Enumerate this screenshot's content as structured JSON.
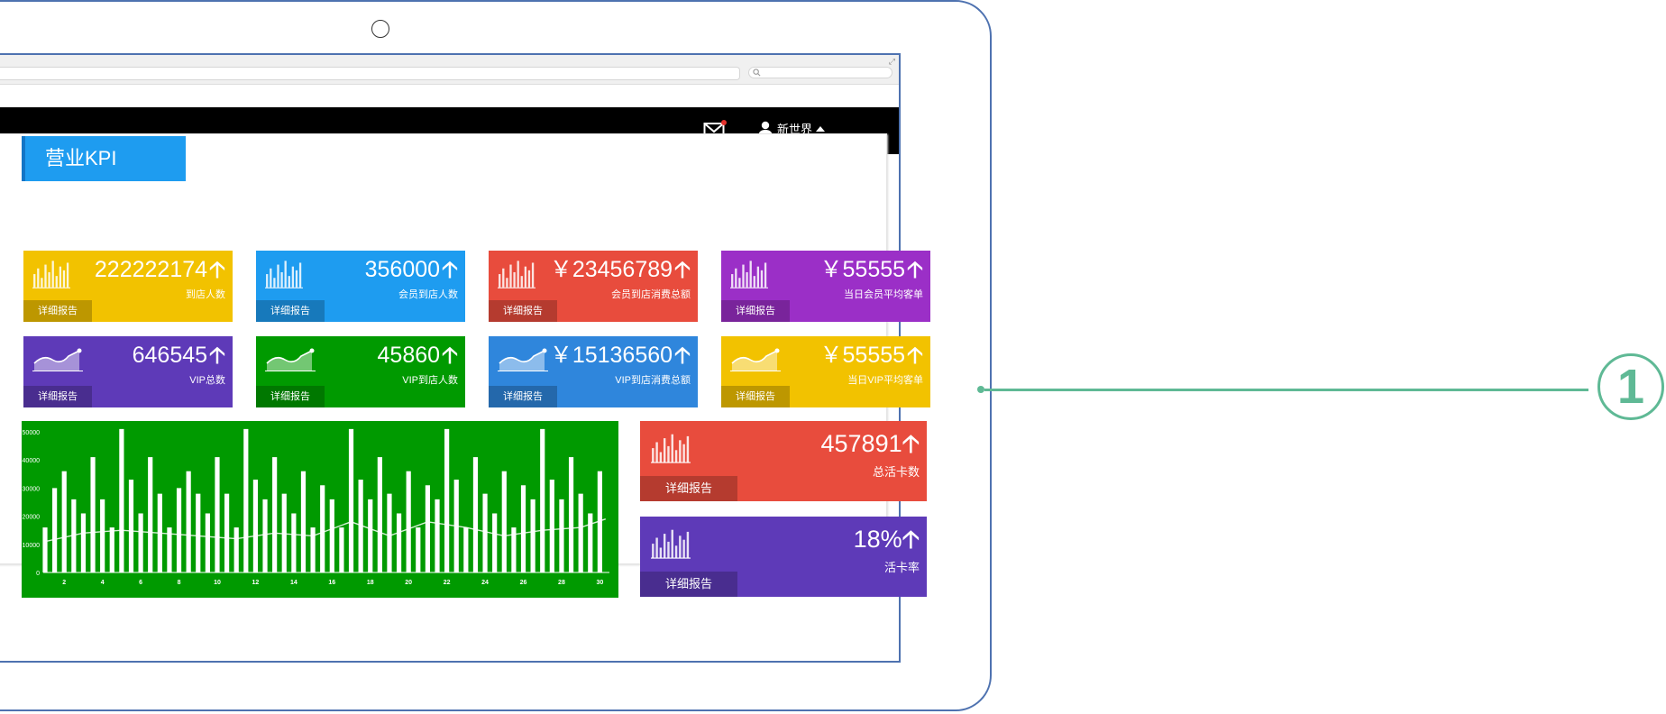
{
  "header": {
    "user_name": "新世界"
  },
  "section": {
    "title": "营业KPI"
  },
  "kpi_cards": [
    {
      "value": "222222174",
      "label": "到店人数",
      "button": "详细报告",
      "color": "#f2c200",
      "icon": "bar-chart-icon"
    },
    {
      "value": "356000",
      "label": "会员到店人数",
      "button": "详细报告",
      "color": "#1e9cf0",
      "icon": "bar-chart-icon"
    },
    {
      "value": "￥23456789",
      "label": "会员到店消费总额",
      "button": "详细报告",
      "color": "#e84c3d",
      "icon": "bar-chart-icon"
    },
    {
      "value": "￥55555",
      "label": "当日会员平均客单",
      "button": "详细报告",
      "color": "#9b2fc7",
      "icon": "bar-chart-icon"
    },
    {
      "value": "646545",
      "label": "VIP总数",
      "button": "详细报告",
      "color": "#5e3ab8",
      "icon": "area-chart-icon"
    },
    {
      "value": "45860",
      "label": "VIP到店人数",
      "button": "详细报告",
      "color": "#009a00",
      "icon": "area-chart-icon"
    },
    {
      "value": "￥15136560",
      "label": "VIP到店消费总额",
      "button": "详细报告",
      "color": "#2f86dc",
      "icon": "area-chart-icon"
    },
    {
      "value": "￥55555",
      "label": "当日VIP平均客单",
      "button": "详细报告",
      "color": "#f2c200",
      "icon": "area-chart-icon"
    }
  ],
  "big_cards": [
    {
      "value": "457891",
      "label": "总活卡数",
      "button": "详细报告",
      "color": "#e84c3d",
      "icon": "bar-chart-icon"
    },
    {
      "value": "18%",
      "label": "活卡率",
      "button": "详细报告",
      "color": "#5e3ab8",
      "icon": "bar-chart-icon"
    }
  ],
  "chart_data": {
    "type": "bar",
    "title": "",
    "xlabel": "",
    "ylabel": "",
    "ylim": [
      0,
      50000
    ],
    "y_ticks": [
      0,
      10000,
      20000,
      30000,
      40000,
      50000
    ],
    "x_ticks": [
      2,
      4,
      6,
      8,
      10,
      12,
      14,
      16,
      18,
      20,
      22,
      24,
      26,
      28,
      30
    ],
    "x_range": [
      1,
      30.5
    ],
    "background": "#009a00",
    "bar_color": "#ffffff",
    "series": [
      {
        "x": [
          1,
          1.5,
          2,
          2.5,
          3,
          3.5,
          4,
          4.5,
          5,
          5.5,
          6,
          6.5,
          7,
          7.5,
          8,
          8.5,
          9,
          9.5,
          10,
          10.5,
          11,
          11.5,
          12,
          12.5,
          13,
          13.5,
          14,
          14.5,
          15,
          15.5,
          16,
          16.5,
          17,
          17.5,
          18,
          18.5,
          19,
          19.5,
          20,
          20.5,
          21,
          21.5,
          22,
          22.5,
          23,
          23.5,
          24,
          24.5,
          25,
          25.5,
          26,
          26.5,
          27,
          27.5,
          28,
          28.5,
          29,
          29.5,
          30
        ],
        "values": [
          16000,
          30000,
          36000,
          26000,
          21000,
          41000,
          26000,
          16000,
          51000,
          33000,
          21000,
          41000,
          28000,
          16000,
          30000,
          36000,
          28000,
          21000,
          41000,
          28000,
          16000,
          51000,
          33000,
          26000,
          41000,
          28000,
          21000,
          36000,
          16000,
          31000,
          26000,
          16000,
          51000,
          33000,
          26000,
          41000,
          28000,
          21000,
          36000,
          16000,
          31000,
          26000,
          51000,
          33000,
          16000,
          41000,
          28000,
          21000,
          36000,
          16000,
          31000,
          26000,
          51000,
          33000,
          26000,
          41000,
          28000,
          21000,
          36000
        ]
      },
      {
        "line": true,
        "x": [
          1,
          3,
          5,
          7,
          9,
          11,
          13,
          15,
          17,
          19,
          21,
          23,
          25,
          27,
          29,
          30.3
        ],
        "values": [
          11000,
          14000,
          15000,
          14000,
          13000,
          12000,
          14000,
          13000,
          18000,
          13000,
          18000,
          16000,
          13000,
          15000,
          16000,
          19000
        ]
      }
    ]
  }
}
